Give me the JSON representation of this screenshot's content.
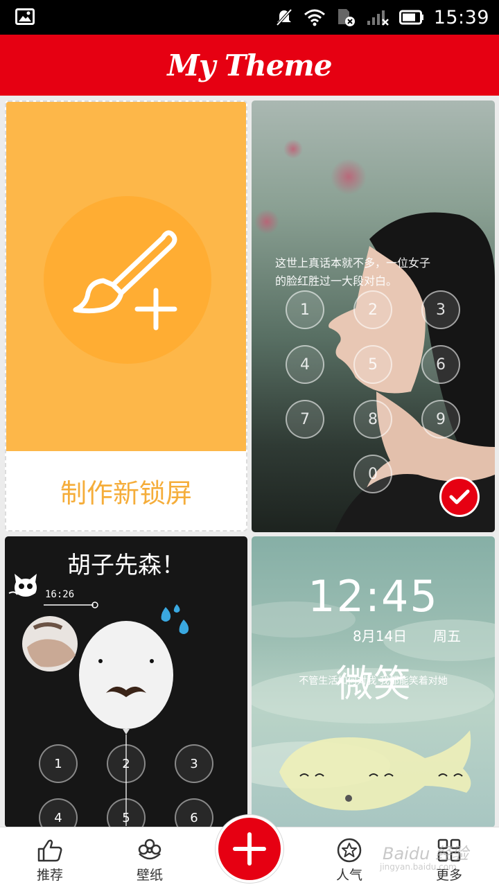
{
  "status_bar": {
    "time": "15:39"
  },
  "header": {
    "title": "My Theme"
  },
  "cards": {
    "create": {
      "label": "制作新锁屏"
    },
    "photo": {
      "caption_line1": "这世上真话本就不多，一位女子",
      "caption_line2": "的脸红胜过一大段对白。",
      "keys": [
        "1",
        "2",
        "3",
        "4",
        "5",
        "6",
        "7",
        "8",
        "9",
        "0"
      ]
    },
    "balloon": {
      "title": "胡子先森！",
      "time": "16:26",
      "keys": [
        "1",
        "2",
        "3",
        "4",
        "5",
        "6"
      ]
    },
    "whale": {
      "time": "12:45",
      "date": "8月14日",
      "weekday": "周五",
      "big_text": "微笑",
      "quote": "不管生活如何对我 我都能笑着对她"
    }
  },
  "bottom_nav": {
    "items": [
      {
        "label": "推荐",
        "icon": "thumbs-up-icon"
      },
      {
        "label": "壁纸",
        "icon": "flower-icon"
      },
      {
        "label": "人气",
        "icon": "star-badge-icon"
      },
      {
        "label": "更多",
        "icon": "grid-icon"
      }
    ],
    "fab_icon": "plus-icon"
  },
  "watermark": {
    "text": "Baidu 经验",
    "sub": "jingyan.baidu.com"
  },
  "colors": {
    "brand_red": "#e60012",
    "create_orange": "#fdb749",
    "create_text": "#f5ad3a"
  }
}
